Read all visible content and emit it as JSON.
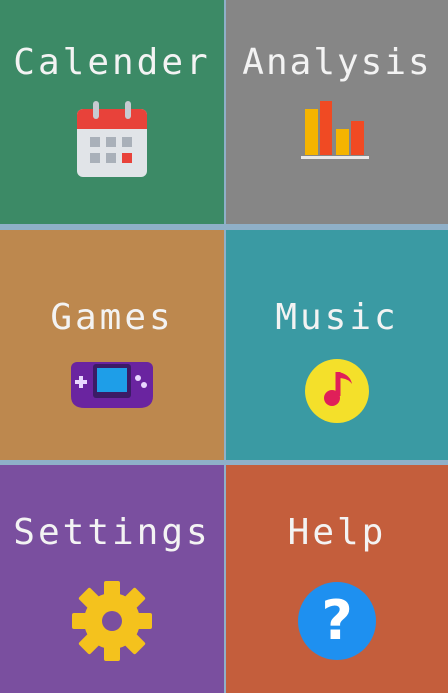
{
  "tiles": [
    {
      "label": "Calender",
      "icon": "calendar-icon",
      "color": "#3c8a66"
    },
    {
      "label": "Analysis",
      "icon": "bar-chart-icon",
      "color": "#868686"
    },
    {
      "label": "Games",
      "icon": "game-console-icon",
      "color": "#bd884e"
    },
    {
      "label": "Music",
      "icon": "music-note-icon",
      "color": "#3a9aa3"
    },
    {
      "label": "Settings",
      "icon": "gear-icon",
      "color": "#7a4f9f"
    },
    {
      "label": "Help",
      "icon": "help-icon",
      "color": "#c45e3c"
    }
  ]
}
